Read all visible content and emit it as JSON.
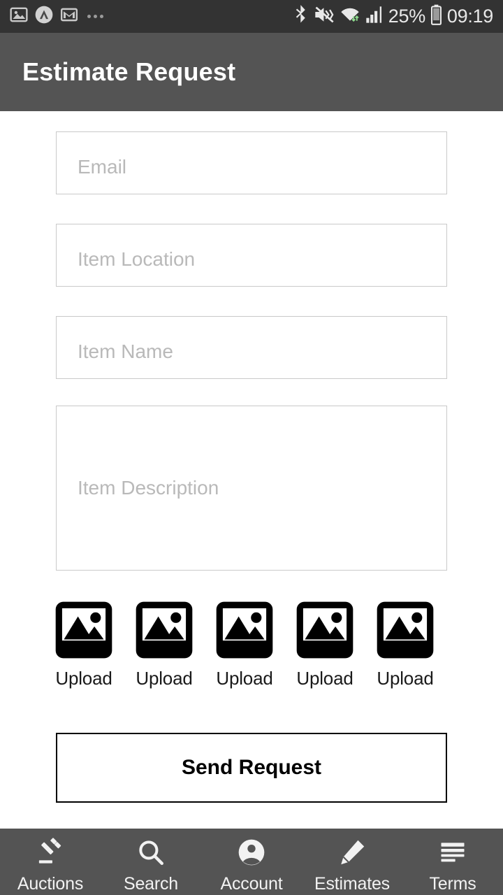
{
  "status_bar": {
    "time": "09:19",
    "battery_percent": "25%",
    "left_icons": [
      "photo-icon",
      "circle-caret-icon",
      "gmail-icon",
      "more-dots-icon"
    ],
    "right_icons": [
      "bluetooth-icon",
      "vibrate-mute-icon",
      "wifi-icon",
      "cellular-signal-icon",
      "battery-icon"
    ],
    "background": "#333333",
    "foreground": "#e8e8e8"
  },
  "app_bar": {
    "title": "Estimate Request",
    "background": "#545454",
    "text_color": "#ffffff"
  },
  "form": {
    "fields": [
      {
        "name": "email",
        "placeholder": "Email",
        "value": "",
        "type": "input"
      },
      {
        "name": "item-location",
        "placeholder": "Item Location",
        "value": "",
        "type": "input"
      },
      {
        "name": "item-name",
        "placeholder": "Item Name",
        "value": "",
        "type": "input"
      },
      {
        "name": "item-description",
        "placeholder": "Item Description",
        "value": "",
        "type": "textarea"
      }
    ],
    "border_color": "#c9c9c9",
    "placeholder_color": "#b9b9b9"
  },
  "uploads": {
    "items": [
      {
        "label": "Upload",
        "icon": "image-upload-icon"
      },
      {
        "label": "Upload",
        "icon": "image-upload-icon"
      },
      {
        "label": "Upload",
        "icon": "image-upload-icon"
      },
      {
        "label": "Upload",
        "icon": "image-upload-icon"
      },
      {
        "label": "Upload",
        "icon": "image-upload-icon"
      }
    ]
  },
  "submit": {
    "label": "Send Request",
    "border_color": "#000000",
    "text_color": "#000000"
  },
  "bottom_nav": {
    "background": "#545454",
    "text_color": "#f2f2f2",
    "items": [
      {
        "label": "Auctions",
        "icon": "gavel-icon"
      },
      {
        "label": "Search",
        "icon": "search-icon"
      },
      {
        "label": "Account",
        "icon": "account-circle-icon"
      },
      {
        "label": "Estimates",
        "icon": "pencil-icon"
      },
      {
        "label": "Terms",
        "icon": "list-lines-icon"
      }
    ]
  }
}
